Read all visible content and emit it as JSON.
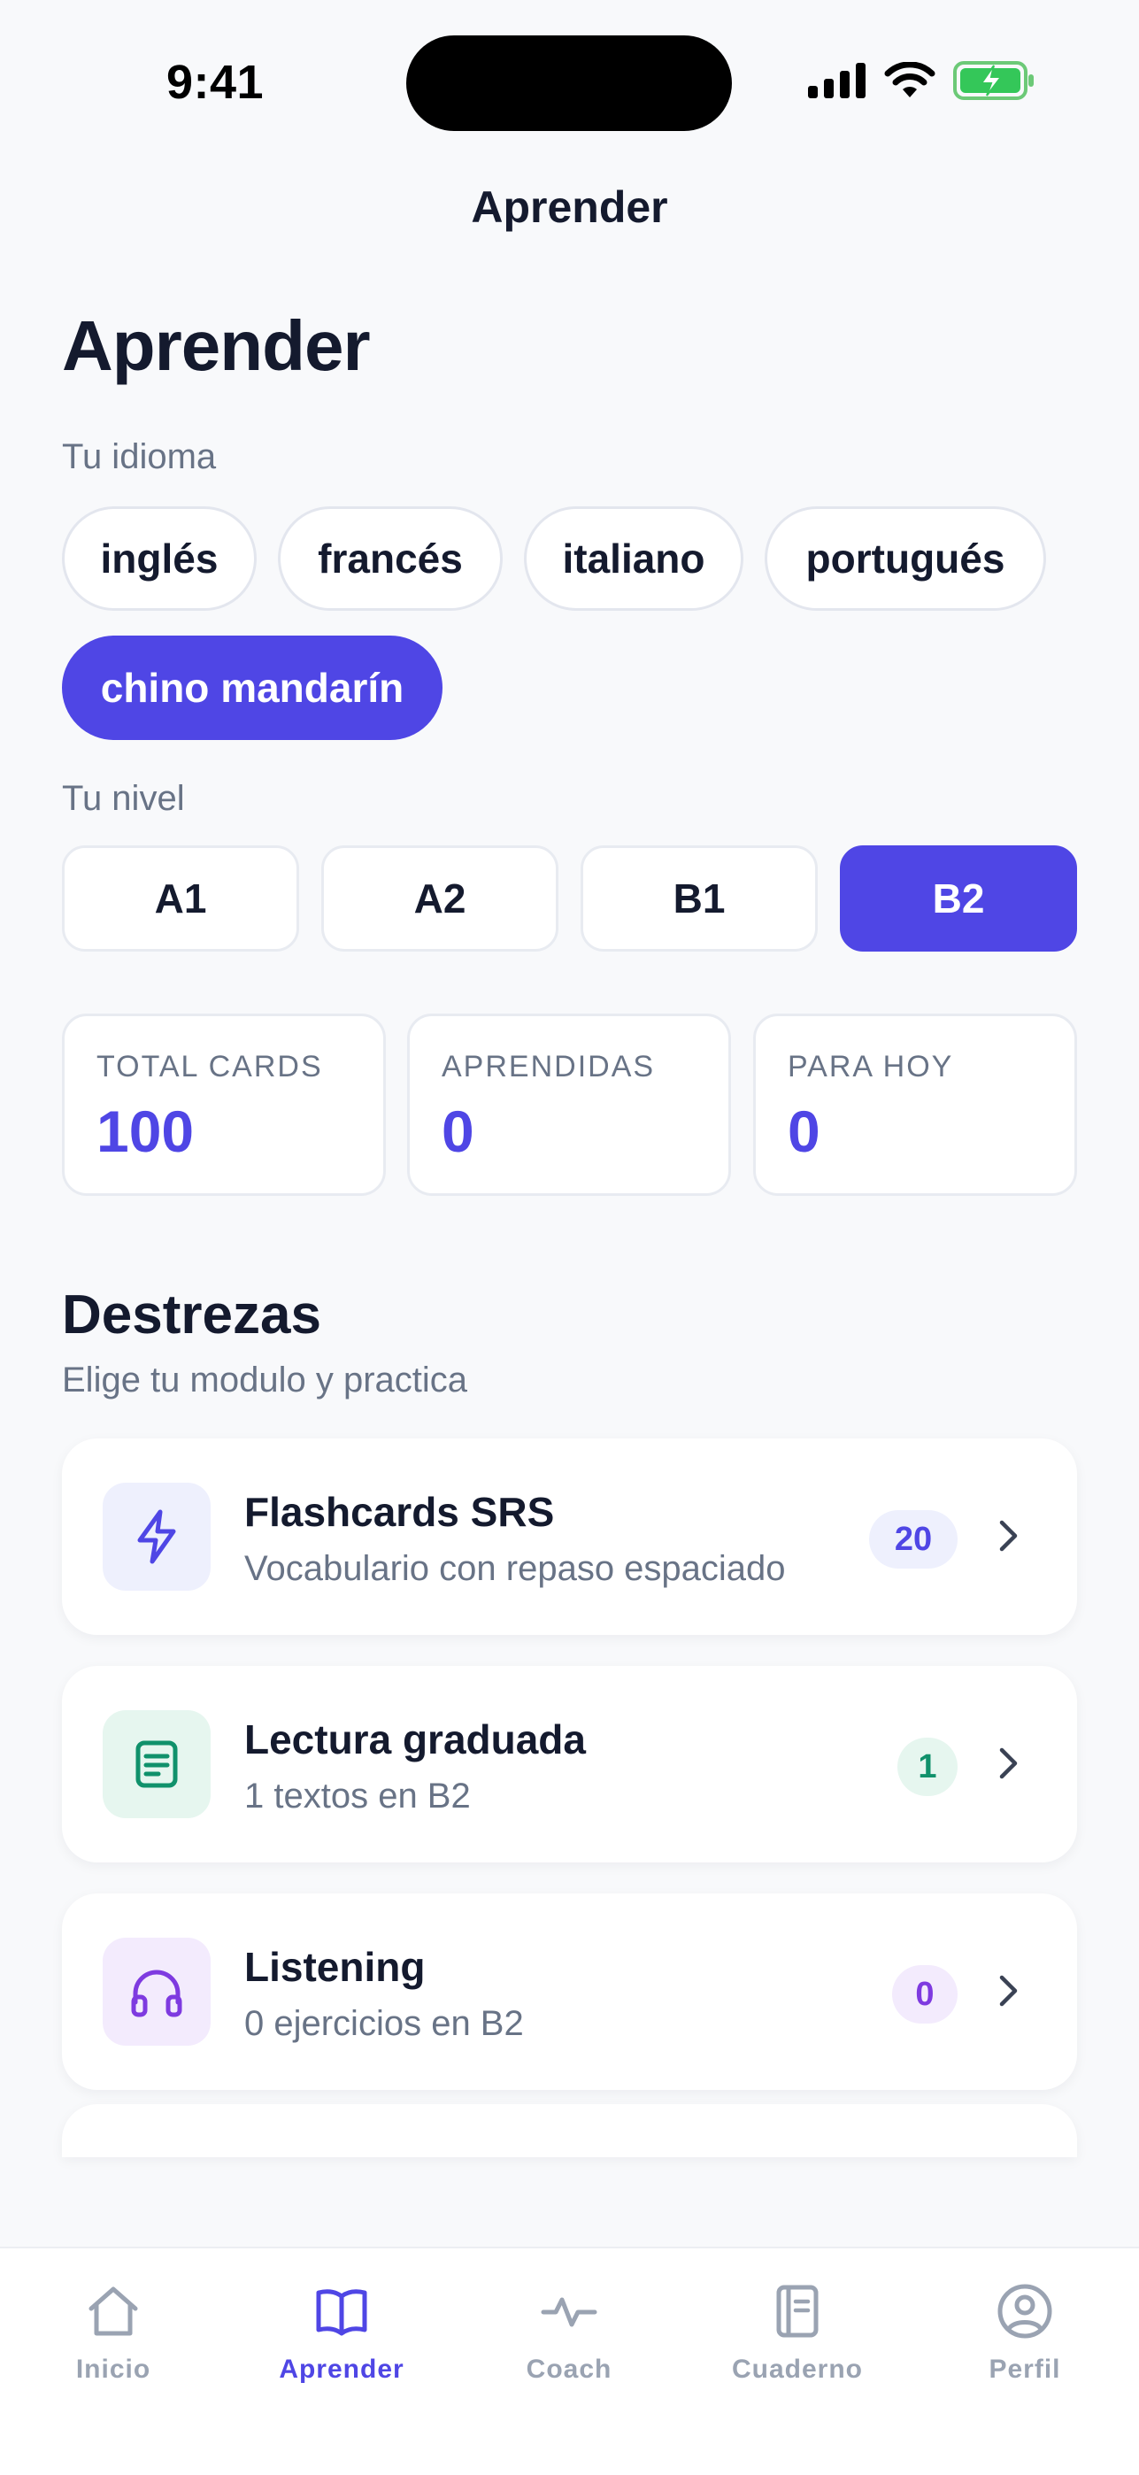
{
  "status_bar": {
    "time": "9:41"
  },
  "nav": {
    "title": "Aprender"
  },
  "page": {
    "heading": "Aprender"
  },
  "language": {
    "label": "Tu idioma",
    "options": [
      "inglés",
      "francés",
      "italiano",
      "portugués",
      "chino mandarín"
    ],
    "selected": "chino mandarín"
  },
  "level": {
    "label": "Tu nivel",
    "options": [
      "A1",
      "A2",
      "B1",
      "B2"
    ],
    "selected": "B2"
  },
  "stats": [
    {
      "label": "TOTAL CARDS",
      "value": "100"
    },
    {
      "label": "APRENDIDAS",
      "value": "0"
    },
    {
      "label": "PARA HOY",
      "value": "0"
    }
  ],
  "destrezas": {
    "title": "Destrezas",
    "subtitle": "Elige tu modulo y practica",
    "modules": [
      {
        "title": "Flashcards SRS",
        "subtitle": "Vocabulario con repaso espaciado",
        "badge": "20",
        "icon": "lightning-icon",
        "accent": "#4f46e5",
        "tint": "#eef0fd"
      },
      {
        "title": "Lectura graduada",
        "subtitle": "1 textos en B2",
        "badge": "1",
        "icon": "document-icon",
        "accent": "#10916b",
        "tint": "#e6f6ef"
      },
      {
        "title": "Listening",
        "subtitle": "0 ejercicios en B2",
        "badge": "0",
        "icon": "headphones-icon",
        "accent": "#7e3ae0",
        "tint": "#f3ebfd"
      }
    ]
  },
  "tab_bar": {
    "tabs": [
      {
        "label": "Inicio",
        "icon": "home-icon"
      },
      {
        "label": "Aprender",
        "icon": "book-icon"
      },
      {
        "label": "Coach",
        "icon": "activity-icon"
      },
      {
        "label": "Cuaderno",
        "icon": "notebook-icon"
      },
      {
        "label": "Perfil",
        "icon": "profile-icon"
      }
    ],
    "active": "Aprender"
  },
  "colors": {
    "accent": "#4f46e5",
    "text_primary": "#141a2e",
    "text_secondary": "#687386",
    "background": "#f8f9fb"
  }
}
